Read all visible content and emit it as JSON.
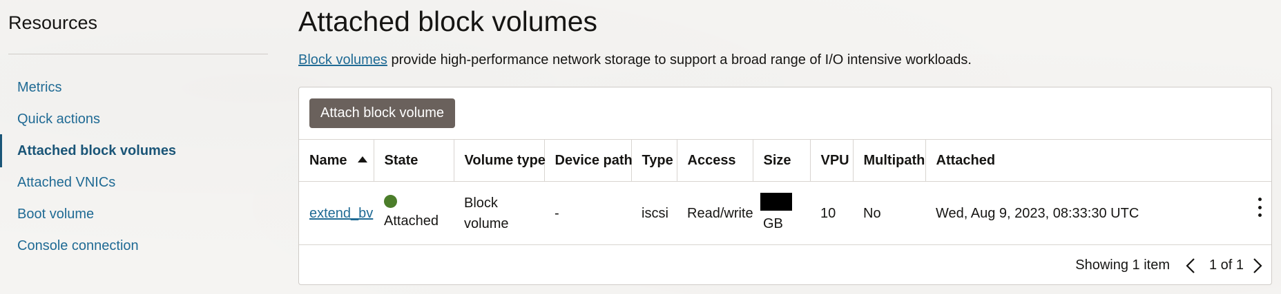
{
  "sidebar": {
    "title": "Resources",
    "items": [
      {
        "label": "Metrics",
        "active": false
      },
      {
        "label": "Quick actions",
        "active": false
      },
      {
        "label": "Attached block volumes",
        "active": true
      },
      {
        "label": "Attached VNICs",
        "active": false
      },
      {
        "label": "Boot volume",
        "active": false
      },
      {
        "label": "Console connection",
        "active": false
      }
    ]
  },
  "main": {
    "title": "Attached block volumes",
    "description_link": "Block volumes",
    "description_text": " provide high-performance network storage to support a broad range of I/O intensive workloads.",
    "attach_button_label": "Attach block volume",
    "table": {
      "columns": [
        "Name",
        "State",
        "Volume type",
        "Device path",
        "Type",
        "Access",
        "Size",
        "VPU",
        "Multipath",
        "Attached"
      ],
      "sort_column": "Name",
      "sort_direction": "ascending",
      "rows": [
        {
          "name": "extend_bv",
          "state": "Attached",
          "state_color": "#4b7d2a",
          "volume_type": "Block volume",
          "device_path": "-",
          "type": "iscsi",
          "access": "Read/write",
          "size_unit": "GB",
          "vpu": "10",
          "multipath": "No",
          "attached": "Wed, Aug 9, 2023, 08:33:30 UTC"
        }
      ]
    },
    "footer": {
      "showing": "Showing 1 item",
      "page_text": "1 of 1"
    }
  },
  "colors": {
    "link": "#1f6a94",
    "button_bg": "#6a615c",
    "status_attached": "#4b7d2a"
  }
}
